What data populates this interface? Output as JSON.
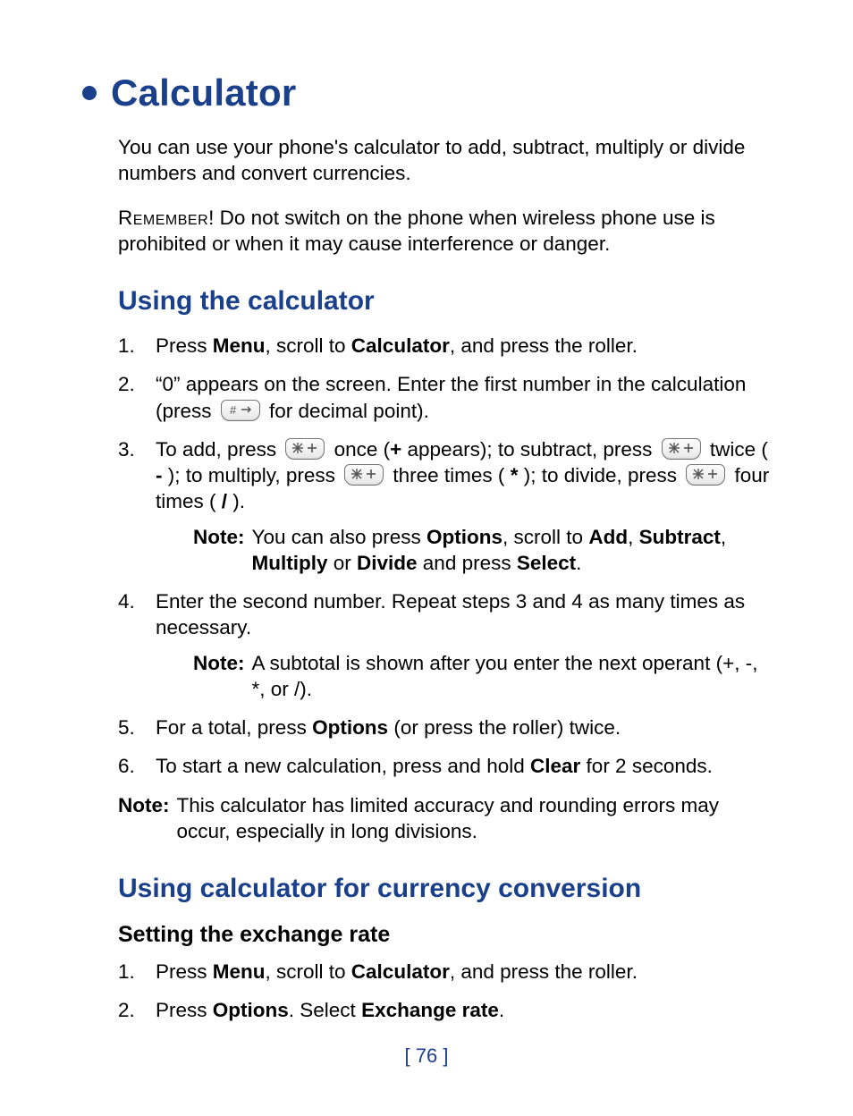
{
  "title": "Calculator",
  "intro": "You can use your phone's calculator to add, subtract, multiply or divide numbers and convert currencies.",
  "remember_label": "Remember",
  "remember_text": "! Do not switch on the phone when wireless phone use is prohibited or when it may cause interference or danger.",
  "section1": {
    "heading": "Using the calculator",
    "step1": {
      "a": "Press ",
      "menu": "Menu",
      "b": ", scroll to ",
      "calc": "Calculator",
      "c": ", and press the roller."
    },
    "step2": {
      "a": "“0” appears on the screen. Enter the first number in the calculation (press ",
      "b": " for decimal point)."
    },
    "step3": {
      "a": "To add, press ",
      "b": " once (",
      "plus": "+",
      "c": " appears); to subtract, press ",
      "d": " twice ( ",
      "minus": "-",
      "e": " ); to multiply, press ",
      "f": " three times ( ",
      "star": "*",
      "g": " ); to divide, press ",
      "h": " four times ( ",
      "slash": "/",
      "i": " )."
    },
    "note1": {
      "label": "Note:",
      "a": " You can also press ",
      "options": "Options",
      "b": ", scroll to ",
      "add": "Add",
      "c": ", ",
      "sub": "Subtract",
      "d": ", ",
      "mul": "Multiply",
      "e": " or ",
      "div": "Divide",
      "f": " and press ",
      "select": "Select",
      "g": "."
    },
    "step4": "Enter the second number. Repeat steps 3 and 4 as many times as necessary.",
    "note2": {
      "label": "Note:",
      "text": " A subtotal is shown after you enter the next operant (+, -, *, or /)."
    },
    "step5": {
      "a": "For a total, press ",
      "options": "Options",
      "b": " (or press the roller) twice."
    },
    "step6": {
      "a": "To start a new calculation, press and hold ",
      "clear": "Clear",
      "b": " for 2 seconds."
    },
    "note3": {
      "label": "Note:",
      "text": " This calculator has limited accuracy and rounding errors may occur, especially in long divisions."
    }
  },
  "section2": {
    "heading": "Using calculator for currency conversion",
    "subheading": "Setting the exchange rate",
    "step1": {
      "a": "Press ",
      "menu": "Menu",
      "b": ", scroll to ",
      "calc": "Calculator",
      "c": ", and press the roller."
    },
    "step2": {
      "a": "Press ",
      "options": "Options",
      "b": ". Select ",
      "rate": "Exchange rate",
      "c": "."
    }
  },
  "page_number": "[ 76 ]"
}
